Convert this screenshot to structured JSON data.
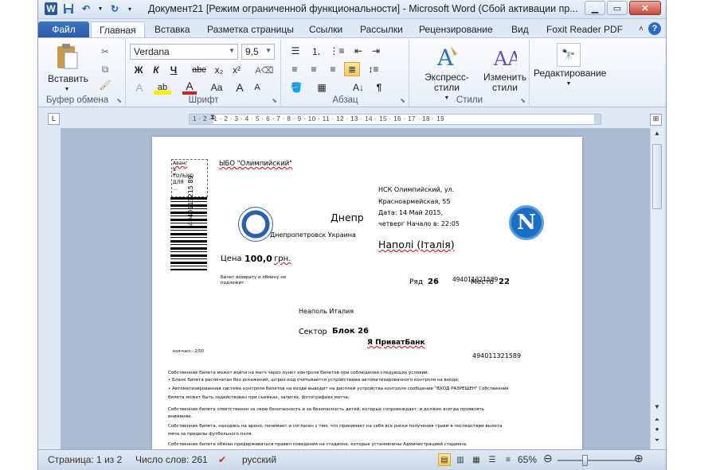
{
  "titlebar": {
    "title": "Документ21 [Режим ограниченной функциональности] - Microsoft Word (Сбой активации пр...",
    "app_logo": "W"
  },
  "tabs": [
    {
      "label": "Файл"
    },
    {
      "label": "Главная"
    },
    {
      "label": "Вставка"
    },
    {
      "label": "Разметка страницы"
    },
    {
      "label": "Ссылки"
    },
    {
      "label": "Рассылки"
    },
    {
      "label": "Рецензирование"
    },
    {
      "label": "Вид"
    },
    {
      "label": "Foxit Reader PDF"
    }
  ],
  "ribbon": {
    "clipboard": {
      "paste_label": "Вставить",
      "group_label": "Буфер обмена"
    },
    "font": {
      "font_name": "Verdana",
      "font_size": "9,5",
      "group_label": "Шрифт",
      "bold": "Ж",
      "italic": "К",
      "underline": "Ч",
      "strike": "abc",
      "sub": "x₂",
      "sup": "x²",
      "grow": "A",
      "shrink": "A",
      "case": "Aa",
      "clear": "A",
      "color": "A",
      "highlight": "ab"
    },
    "paragraph": {
      "group_label": "Абзац",
      "pilcrow": "¶"
    },
    "styles": {
      "express_label": "Экспресс-стили",
      "change_label_1": "Изменить",
      "change_label_2": "стили",
      "group_label": "Стили"
    },
    "editing": {
      "label": "Редактирование"
    }
  },
  "ruler": {
    "marks": "1 · 2 · 1 · 2 · 3 · 4 · 5 · 6 · 7 · 8 · 9 · 10 · 11 · 12 · 13 · 14 · 15 · 16 · 17 · 18 · 19"
  },
  "document": {
    "org": "ЫБО \"Олимпийский\"",
    "stamp_lines": [
      "Аванг",
      "а",
      "ТОЛЬКО",
      "ДЛЯ",
      "..."
    ],
    "barcode_vertical": "4940113215 89",
    "address_1": "НСК Олимпийский,  ул.",
    "address_2": "Красноармейская, 55",
    "date": "Дата: 14 Май 2015,",
    "time": "четверг Начало в: 22:05",
    "home_team": "Днепр",
    "home_team_full": "Днепропетровск Украина",
    "away_team": "Наполі (Італія)",
    "price_label": "Цена",
    "price_value": "100,0",
    "price_currency": "грн.",
    "return_note": "Билет возврату и обмену не подлежит",
    "row_label": "Ряд",
    "row_value": "26",
    "seat_label": "Место",
    "seat_value": "22",
    "ticket_code_small": "494011321589",
    "venue": "Неаполь Италия",
    "sector_label": "Сектор",
    "sector_value": "Блок 26",
    "bank": "Я ПриватБанк",
    "ticket_code": "494011321589",
    "cashier": "кол-касс.- 2/00",
    "rules": [
      "Собственник билета может войти на матч через пункт контроля билетов при соблюдении следующих условий:",
      "• Бланк билета распечатан без искажений, штрих-код считывается устройствами автоматизированного контроля на входе;",
      "• Автоматизированная система контроля билетов на входе выводит на дисплей устройства контроля сообщение \"ВХОД РАЗРЕШЕН\" Собственник",
      "билета может быть задействован при съемках, записях, фотографиях матча.",
      "Собственник билета ответственен за свою безопасность и за безопасность детей, которых сопровождает, и должен всегда проявлять",
      "внимание.",
      "Собственник билета, находясь на арене, понимает и согласен с тем, что принимает на себя все риски получения травм в последствии вылета",
      "мяча за пределы футбольного поля.",
      "Собственник билета обязан придерживаться правил поведения на стадионе, которые установлены Администрацией стадиона."
    ]
  },
  "status": {
    "page": "Страница: 1 из 2",
    "words": "Число слов: 261",
    "language": "русский",
    "zoom": "65%",
    "zoom_level": 0.35
  }
}
